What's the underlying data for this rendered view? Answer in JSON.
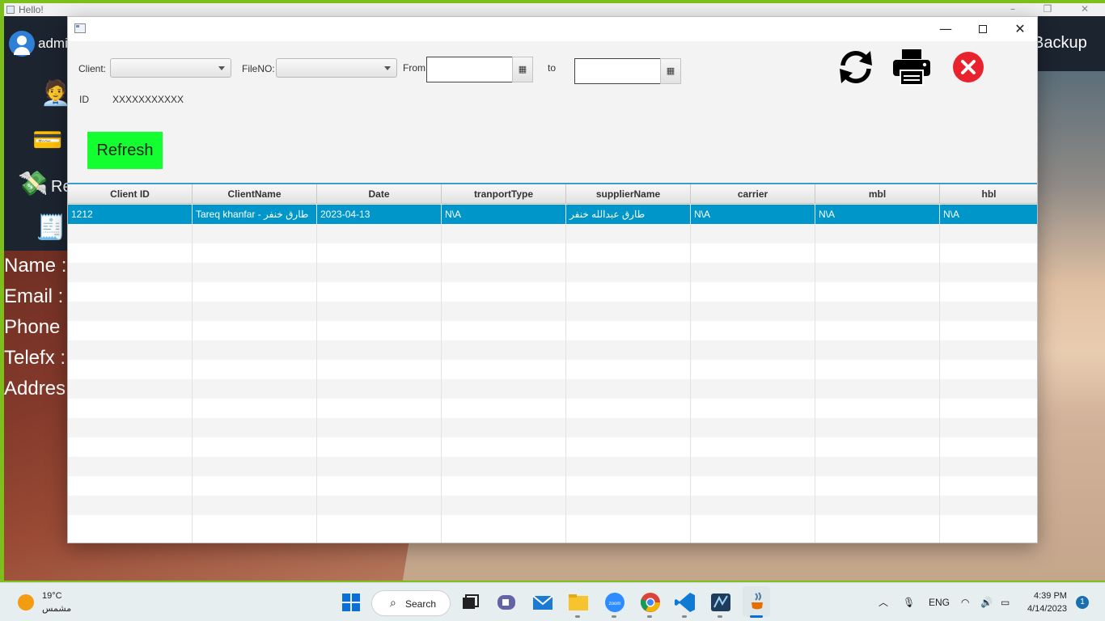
{
  "background_app": {
    "title": "Hello!",
    "user": "admi",
    "sidebar_partial_label": "Re",
    "backup_label": "Backup",
    "fields": [
      "Name :",
      "Email :",
      "Phone :",
      "Telefx :",
      "Addres"
    ]
  },
  "filters": {
    "client_label": "Client:",
    "fileno_label": "FileNO:",
    "from_label": "From",
    "to_label": "to",
    "id_label": "ID",
    "id_value": "XXXXXXXXXXX",
    "date_button_glyph": "▦"
  },
  "buttons": {
    "refresh": "Refresh"
  },
  "icons": {
    "reload": "reload-icon",
    "print": "printer-icon",
    "close": "close-circle-icon"
  },
  "table": {
    "columns": [
      "Client ID",
      "ClientName",
      "Date",
      "tranportType",
      "supplierName",
      "carrier",
      "mbl",
      "hbl"
    ],
    "rows": [
      [
        "1212",
        "Tareq khanfar - طارق خنفر",
        "2023-04-13",
        "N\\A",
        "طارق عبدالله خنفر",
        "N\\A",
        "N\\A",
        "N\\A"
      ]
    ],
    "selected_row_color": "#0096c9"
  },
  "taskbar": {
    "weather_temp": "19°C",
    "weather_desc": "مشمس",
    "search": "Search",
    "language": "ENG",
    "time": "4:39 PM",
    "date": "4/14/2023",
    "notifications": "1"
  },
  "colors": {
    "refresh_button": "#14ff2f",
    "close_icon": "#e8232e",
    "accent": "#3d9bd3"
  }
}
